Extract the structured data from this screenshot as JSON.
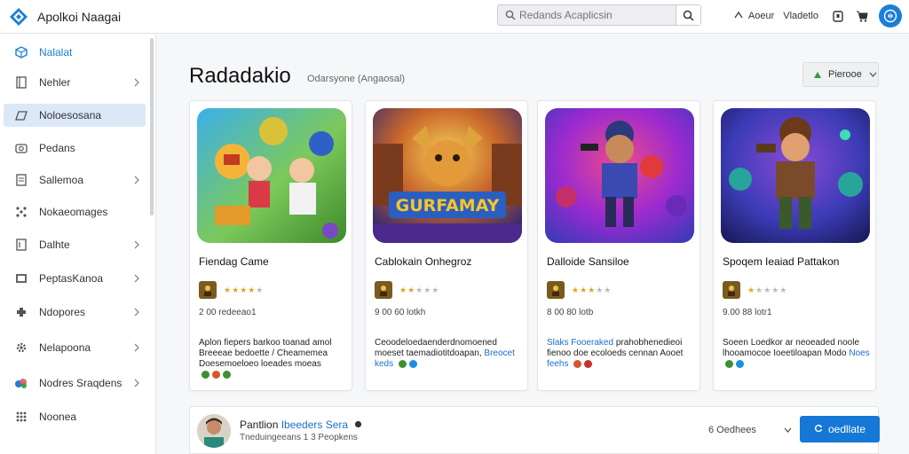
{
  "app": {
    "title": "Apolkoi Naagai"
  },
  "search": {
    "placeholder": "Redands Acaplicsin"
  },
  "topbar": {
    "link1": "Aoeur",
    "link2": "Vladetlo"
  },
  "sidebar": {
    "items": [
      {
        "label": "Nalalat",
        "icon": "cube-icon",
        "chevron": false,
        "active": false,
        "color": "#1a7fd8"
      },
      {
        "label": "Nehler",
        "icon": "book-icon",
        "chevron": true,
        "active": false
      },
      {
        "label": "Noloesosana",
        "icon": "chat-icon",
        "chevron": false,
        "active": true
      },
      {
        "label": "Pedans",
        "icon": "camera-icon",
        "chevron": false,
        "active": false
      },
      {
        "label": "Sallemoa",
        "icon": "document-icon",
        "chevron": true,
        "active": false
      },
      {
        "label": "Nokaeomages",
        "icon": "grid-dots-icon",
        "chevron": false,
        "active": false
      },
      {
        "label": "Dalhte",
        "icon": "page-icon",
        "chevron": true,
        "active": false
      },
      {
        "label": "PeptasKanoa",
        "icon": "image-icon",
        "chevron": true,
        "active": false
      },
      {
        "label": "Ndopores",
        "icon": "puzzle-icon",
        "chevron": true,
        "active": false
      },
      {
        "label": "Nelapoona",
        "icon": "gear-icon",
        "chevron": true,
        "active": false
      },
      {
        "label": "Nodres Sraqdens",
        "icon": "colorful-badge-icon",
        "chevron": true,
        "active": false
      },
      {
        "label": "Noonea",
        "icon": "apps-grid-icon",
        "chevron": false,
        "active": false
      }
    ]
  },
  "main": {
    "title": "Radadakio",
    "subtitle": "Odarsyone (Angaosal)",
    "filter": {
      "label": "Pierooe",
      "accent": "#2e9b3e"
    }
  },
  "cards": [
    {
      "title": "Fiendag Came",
      "rating": 4,
      "count": "2 00 redeeao1",
      "desc": [
        {
          "text": "Aplon fiepers barkoo toanad amol Breeeae bedoette / Cheamemea Doesemoeloeo loeades moeas"
        }
      ],
      "desc_icons": [
        "#3f8f34",
        "#d8562a",
        "#3f8f34"
      ],
      "thumb_title": "",
      "palette": [
        "#43b3e8",
        "#8ed35a",
        "#f4b43a"
      ]
    },
    {
      "title": "Cablokain Onhegroz",
      "rating": 2,
      "count": "9 00 60 lotkh",
      "desc": [
        {
          "text": "Ceoodeloedaenderdnomoened moeset taemadiotitdoapan, "
        },
        {
          "text": "Breocet keds",
          "accent": true
        }
      ],
      "desc_icons": [
        "#3f8f34",
        "#1a8fe0"
      ],
      "thumb_title": "GURFAMAY",
      "palette": [
        "#2a6fc4",
        "#f2a81c",
        "#c23b1e"
      ]
    },
    {
      "title": "Dalloide Sansiloe",
      "rating": 3,
      "count": "8 00 80 lotb",
      "desc": [
        {
          "text": "Slaks Fooeraked",
          "accent": true
        },
        {
          "text": " prahobhenedieoi fienoo doe ecoloeds cennan Aooet "
        },
        {
          "text": "feehs",
          "accent": true
        }
      ],
      "desc_icons": [
        "#d8562a",
        "#c9302c"
      ],
      "thumb_title": "",
      "palette": [
        "#e23a8a",
        "#8a2bd6",
        "#3a6bd6"
      ]
    },
    {
      "title": "Spoqem Ieaiad Pattakon",
      "rating": 1,
      "count": "9.00 88 lotr1",
      "desc": [
        {
          "text": "Soeen Loedkor ar neoeaded noole lhooamocoe Ioeetiloapan Modo "
        },
        {
          "text": "Noes",
          "accent": true
        }
      ],
      "desc_icons": [
        "#3f8f34",
        "#1a8fe0"
      ],
      "thumb_title": "",
      "palette": [
        "#3b3bb5",
        "#6a2ab8",
        "#27a59a"
      ]
    }
  ],
  "bottom": {
    "title_a": "Pantlion ",
    "title_b": "Ibeeders Sera",
    "subtitle": "Tneduingeeans 1 3 Peopkens",
    "select_label": "6 Oedhees",
    "cta_label": "oedllate"
  },
  "colors": {
    "accent": "#1577d6",
    "star": "#e0a526"
  }
}
